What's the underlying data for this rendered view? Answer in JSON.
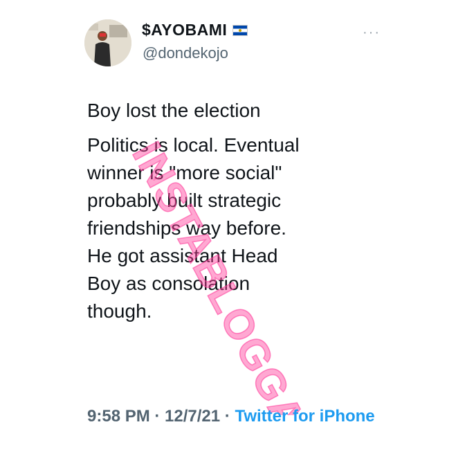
{
  "tweet": {
    "display_name": "$AYOBAMI",
    "flag_icon": "el-salvador-flag-icon",
    "handle": "@dondekojo",
    "more_icon": "more-icon",
    "body_line1": "Boy lost the election",
    "body_paragraph": "Politics is local. Eventual\nwinner is \"more social\"\nprobably built strategic\nfriendships way before.\nHe got assistant Head\nBoy as consolation\nthough.",
    "time": "9:58 PM",
    "separator": " · ",
    "date": "12/7/21",
    "source_prefix": " · ",
    "source": "Twitter for iPhone"
  },
  "watermark": {
    "text": "INSTABLOGGA"
  }
}
